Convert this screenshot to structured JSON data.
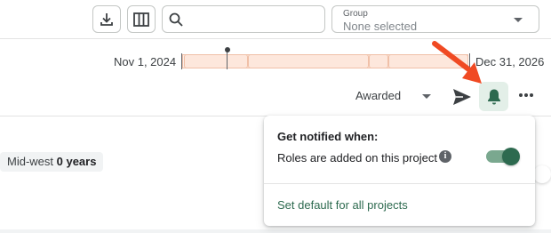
{
  "toolbar": {
    "download_icon": "download-icon",
    "columns_icon": "columns-icon",
    "search": {
      "placeholder": "",
      "value": ""
    },
    "group": {
      "label": "Group",
      "value": "None selected"
    }
  },
  "timeline": {
    "start_date": "Nov 1, 2024",
    "end_date": "Dec 31, 2026"
  },
  "actions": {
    "status": "Awarded",
    "send_icon": "send-icon",
    "bell_icon": "bell-icon",
    "more_icon": "more-horizontal-icon"
  },
  "card": {
    "region": "Mid-west",
    "duration": "0 years"
  },
  "notify_popover": {
    "title": "Get notified when:",
    "option_label": "Roles are added on this project",
    "info_glyph": "i",
    "option_enabled": true,
    "default_link": "Set default for all projects"
  },
  "colors": {
    "accent": "#2d6a4f",
    "arrow": "#f04a23",
    "timeline_fill": "#fdeee6"
  }
}
